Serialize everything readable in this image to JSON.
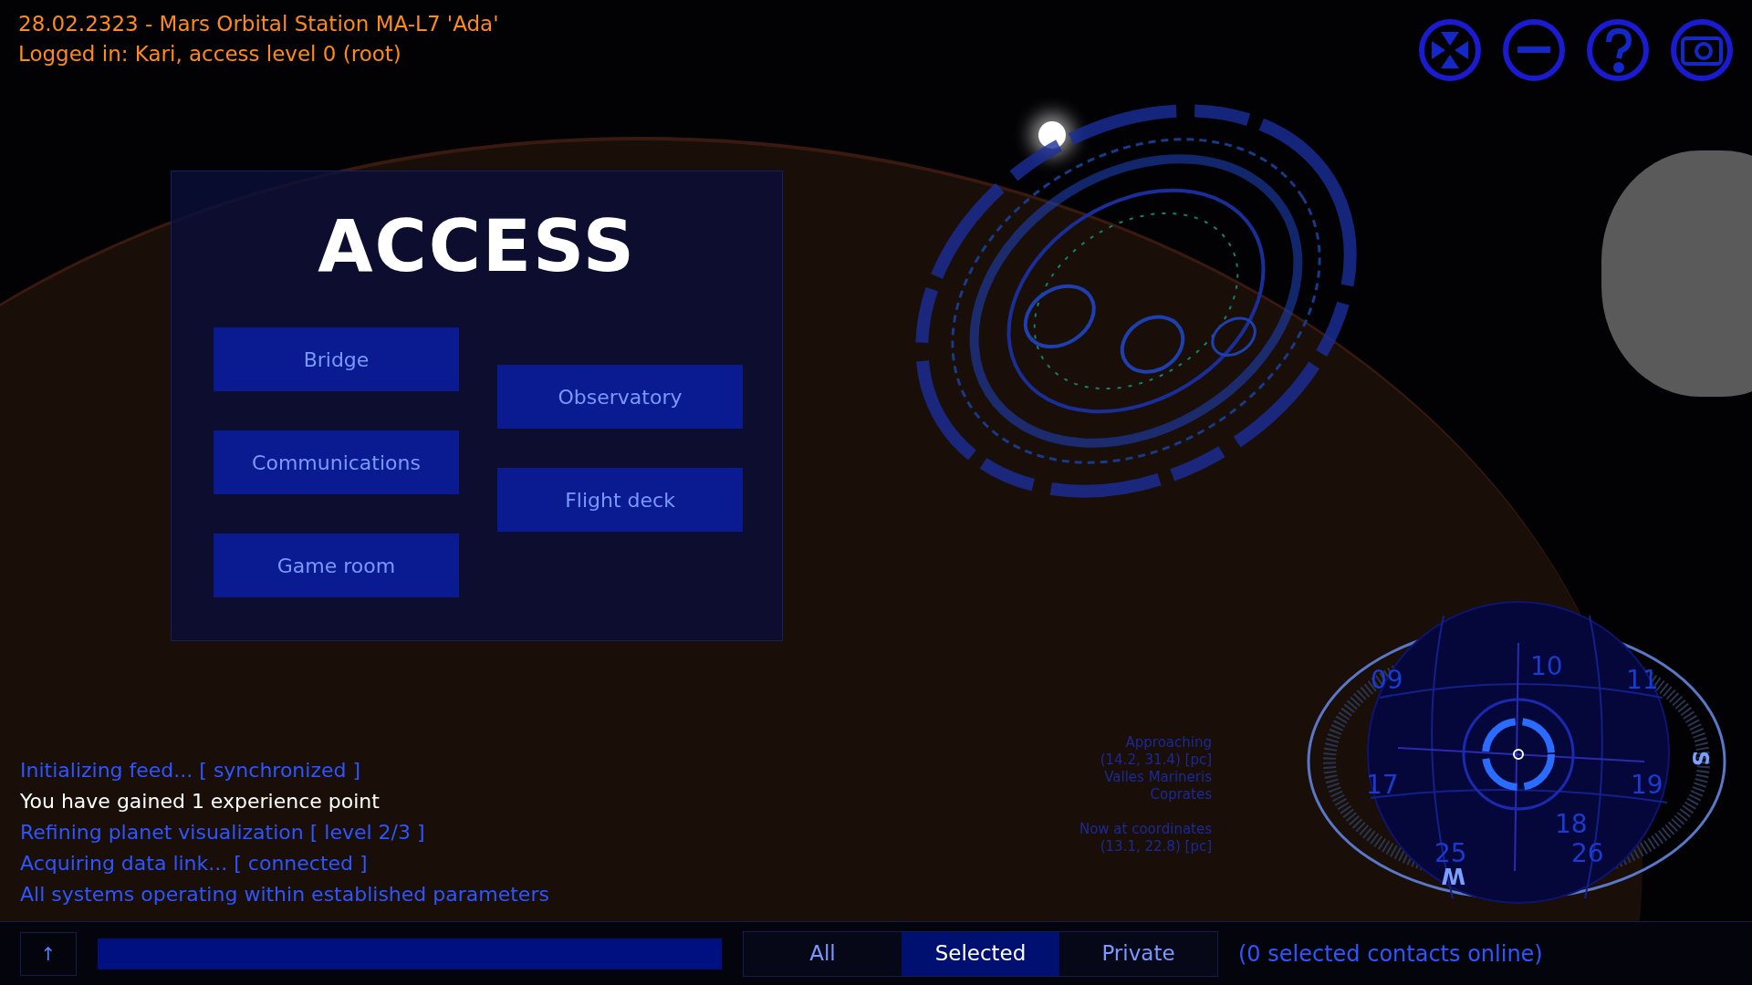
{
  "header": {
    "title": "28.02.2323 - Mars Orbital Station MA-L7 'Ada'",
    "login": "Logged in: Kari, access level 0 (root)"
  },
  "window_controls": [
    {
      "kind": "move"
    },
    {
      "kind": "minimize"
    },
    {
      "kind": "help"
    },
    {
      "kind": "screenshot"
    }
  ],
  "access_panel": {
    "title": "ACCESS",
    "left_buttons": [
      "Bridge",
      "Communications",
      "Game room"
    ],
    "right_buttons": [
      "Observatory",
      "Flight deck"
    ]
  },
  "log": [
    {
      "kind": "info",
      "text": "Initializing feed... [ synchronized ]"
    },
    {
      "kind": "highlight",
      "text": "You have gained 1 experience point"
    },
    {
      "kind": "info",
      "text": "Refining planet visualization [ level 2/3 ]"
    },
    {
      "kind": "info",
      "text": "Acquiring data link... [ connected ]"
    },
    {
      "kind": "info",
      "text": "All systems operating within established parameters"
    }
  ],
  "navigation": {
    "approach": [
      "Approaching",
      "(14.2, 31.4) [pc]",
      "Valles Marineris",
      "Coprates"
    ],
    "position": [
      "Now at coordinates",
      "(13.1, 22.8) [pc]"
    ]
  },
  "globe": {
    "labels": [
      "09",
      "10",
      "11",
      "17",
      "18",
      "19",
      "25",
      "26"
    ],
    "compass": [
      "S",
      "W"
    ]
  },
  "chat": {
    "up_button": "↑",
    "tabs": [
      {
        "label": "All",
        "selected": false
      },
      {
        "label": "Selected",
        "selected": true
      },
      {
        "label": "Private",
        "selected": false
      }
    ],
    "status": "(0 selected contacts online)"
  }
}
